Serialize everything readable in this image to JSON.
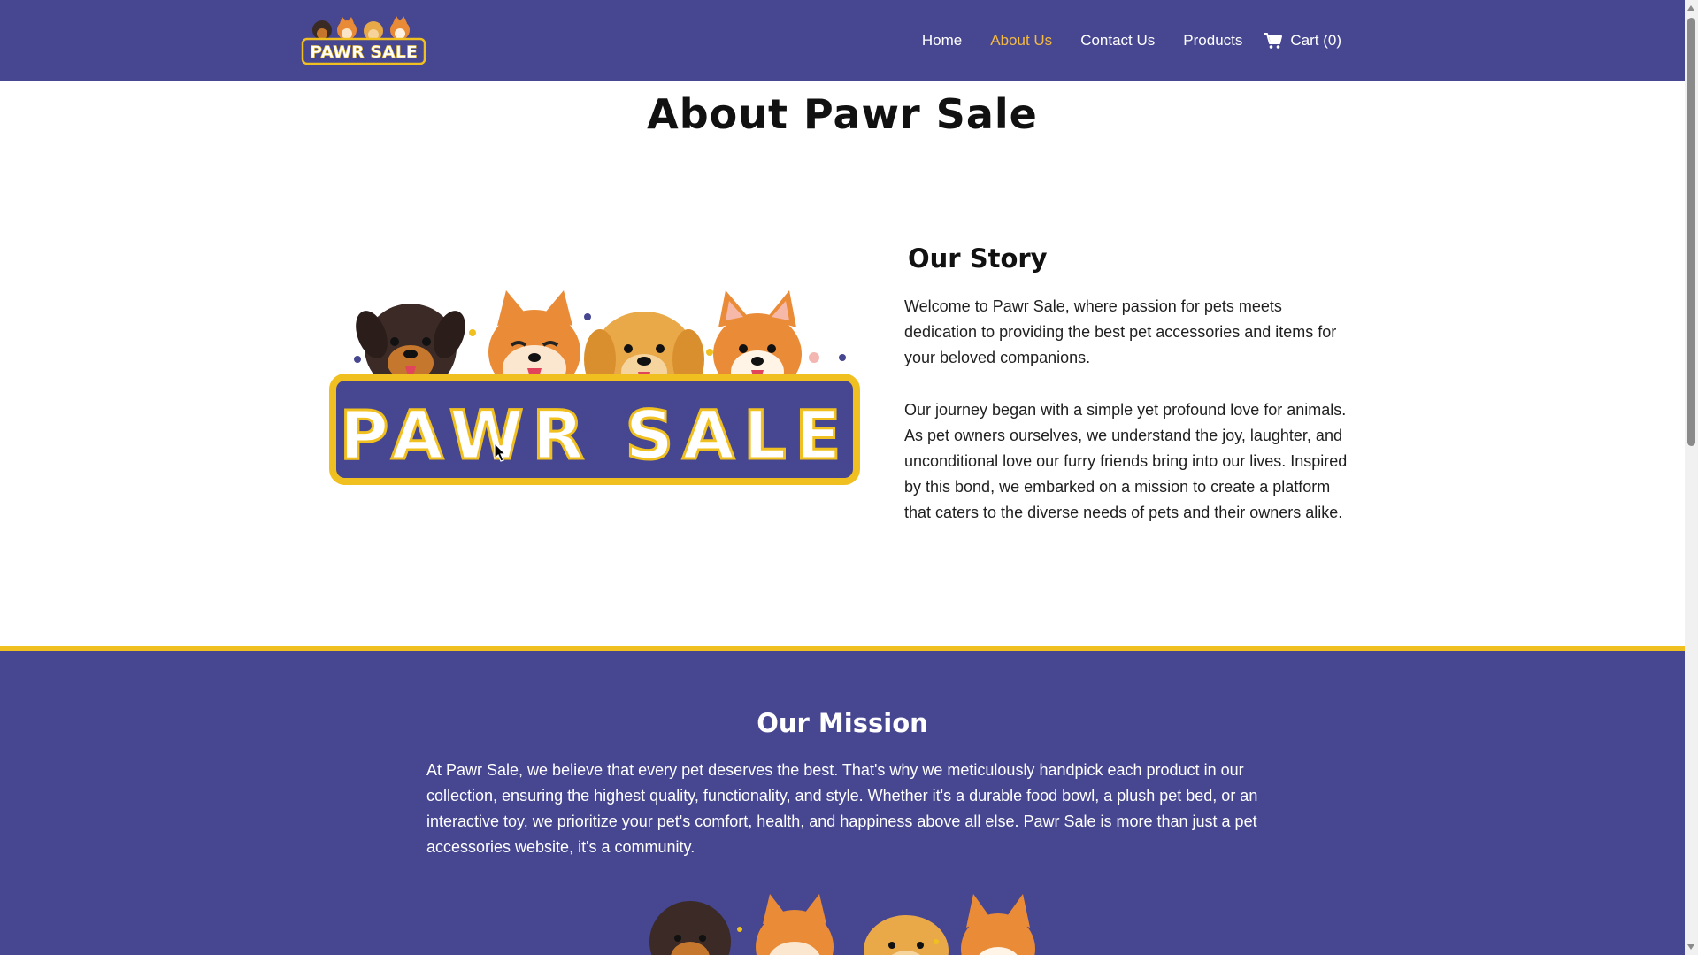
{
  "brand": {
    "logo_text": "PAWR SALE"
  },
  "nav": {
    "links": [
      {
        "label": "Home",
        "active": false
      },
      {
        "label": "About Us",
        "active": true
      },
      {
        "label": "Contact Us",
        "active": false
      },
      {
        "label": "Products",
        "active": false
      }
    ],
    "cart_label": "Cart (0)",
    "cart_icon": "cart-icon"
  },
  "page": {
    "title": "About Pawr Sale"
  },
  "story": {
    "heading": "Our Story",
    "paragraphs": [
      "Welcome to Pawr Sale, where passion for pets meets dedication to providing the best pet accessories and items for your beloved companions.",
      "Our journey began with a simple yet profound love for animals. As pet owners ourselves, we understand the joy, laughter, and unconditional love our furry friends bring into our lives. Inspired by this bond, we embarked on a mission to create a platform that caters to the diverse needs of pets and their owners alike."
    ]
  },
  "mission": {
    "heading": "Our Mission",
    "text": "At Pawr Sale, we believe that every pet deserves the best. That's why we meticulously handpick each product in our collection, ensuring the highest quality, functionality, and style. Whether it's a durable food bowl, a plush pet bed, or an interactive toy, we prioritize your pet's comfort, health, and happiness above all else. Pawr Sale is more than just a pet accessories website, it's a community."
  },
  "colors": {
    "nav_bg": "#464691",
    "accent_gold": "#f4b942",
    "border_gold": "#f0c020",
    "white": "#ffffff"
  }
}
